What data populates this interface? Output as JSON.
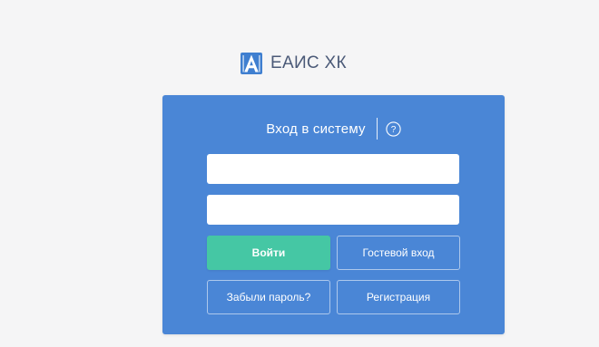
{
  "brand": {
    "logo_icon": "eais-logo-icon",
    "name": "ЕАИС ХК"
  },
  "login_form": {
    "title": "Вход в систему",
    "help_icon": "question-circle-icon",
    "login_field": {
      "value": "",
      "placeholder": ""
    },
    "password_field": {
      "value": "",
      "placeholder": ""
    },
    "buttons": {
      "login": "Войти",
      "guest": "Гостевой вход",
      "forgot_password": "Забыли пароль?",
      "register": "Регистрация"
    }
  },
  "colors": {
    "page_background": "#f5f5f6",
    "card_background": "#4a86d6",
    "primary_button": "#45c7a4",
    "brand_text": "#4b5a78"
  }
}
